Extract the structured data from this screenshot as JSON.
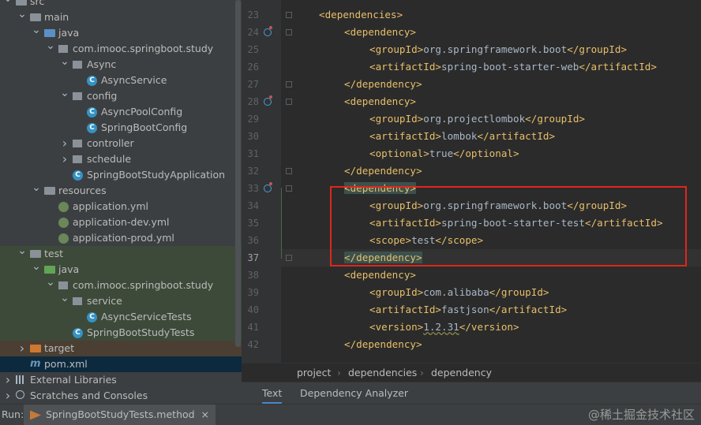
{
  "tree": {
    "items": [
      {
        "label": "src",
        "indent": 0,
        "arrow": "v",
        "icon": "folder"
      },
      {
        "label": "main",
        "indent": 1,
        "arrow": "v",
        "icon": "folder"
      },
      {
        "label": "java",
        "indent": 2,
        "arrow": "v",
        "icon": "folder-blue"
      },
      {
        "label": "com.imooc.springboot.study",
        "indent": 3,
        "arrow": "v",
        "icon": "package"
      },
      {
        "label": "Async",
        "indent": 4,
        "arrow": "v",
        "icon": "package"
      },
      {
        "label": "AsyncService",
        "indent": 5,
        "arrow": "",
        "icon": "class"
      },
      {
        "label": "config",
        "indent": 4,
        "arrow": "v",
        "icon": "package"
      },
      {
        "label": "AsyncPoolConfig",
        "indent": 5,
        "arrow": "",
        "icon": "class"
      },
      {
        "label": "SpringBootConfig",
        "indent": 5,
        "arrow": "",
        "icon": "class"
      },
      {
        "label": "controller",
        "indent": 4,
        "arrow": ">",
        "icon": "package"
      },
      {
        "label": "schedule",
        "indent": 4,
        "arrow": ">",
        "icon": "package"
      },
      {
        "label": "SpringBootStudyApplication",
        "indent": 4,
        "arrow": "",
        "icon": "class"
      },
      {
        "label": "resources",
        "indent": 2,
        "arrow": "v",
        "icon": "folder-res"
      },
      {
        "label": "application.yml",
        "indent": 3,
        "arrow": "",
        "icon": "yml"
      },
      {
        "label": "application-dev.yml",
        "indent": 3,
        "arrow": "",
        "icon": "yml"
      },
      {
        "label": "application-prod.yml",
        "indent": 3,
        "arrow": "",
        "icon": "yml"
      },
      {
        "label": "test",
        "indent": 1,
        "arrow": "v",
        "icon": "folder",
        "bg": "test"
      },
      {
        "label": "java",
        "indent": 2,
        "arrow": "v",
        "icon": "folder-green",
        "bg": "test"
      },
      {
        "label": "com.imooc.springboot.study",
        "indent": 3,
        "arrow": "v",
        "icon": "package",
        "bg": "test"
      },
      {
        "label": "service",
        "indent": 4,
        "arrow": "v",
        "icon": "package",
        "bg": "test"
      },
      {
        "label": "AsyncServiceTests",
        "indent": 5,
        "arrow": "",
        "icon": "class",
        "bg": "test"
      },
      {
        "label": "SpringBootStudyTests",
        "indent": 4,
        "arrow": "",
        "icon": "class",
        "bg": "test"
      },
      {
        "label": "target",
        "indent": 1,
        "arrow": ">",
        "icon": "folder-orange",
        "bg": "target"
      },
      {
        "label": "pom.xml",
        "indent": 1,
        "arrow": "",
        "icon": "maven",
        "bg": "sel"
      },
      {
        "label": "External Libraries",
        "indent": 0,
        "arrow": ">",
        "icon": "libs"
      },
      {
        "label": "Scratches and Consoles",
        "indent": 0,
        "arrow": ">",
        "icon": "scratch"
      }
    ]
  },
  "editor": {
    "first_line": 23,
    "current_line": 37,
    "lines": [
      {
        "n": 23,
        "indent": 1,
        "parts": [
          [
            "tg",
            "<dependencies>"
          ]
        ]
      },
      {
        "n": 24,
        "indent": 2,
        "parts": [
          [
            "tg",
            "<dependency>"
          ]
        ],
        "gicon": true
      },
      {
        "n": 25,
        "indent": 3,
        "parts": [
          [
            "tg",
            "<groupId>"
          ],
          [
            "tx",
            "org.springframework.boot"
          ],
          [
            "tg",
            "</groupId>"
          ]
        ]
      },
      {
        "n": 26,
        "indent": 3,
        "parts": [
          [
            "tg",
            "<artifactId>"
          ],
          [
            "tx",
            "spring-boot-starter-web"
          ],
          [
            "tg",
            "</artifactId>"
          ]
        ]
      },
      {
        "n": 27,
        "indent": 2,
        "parts": [
          [
            "tg",
            "</dependency>"
          ]
        ]
      },
      {
        "n": 28,
        "indent": 2,
        "parts": [
          [
            "tg",
            "<dependency>"
          ]
        ],
        "gicon": true
      },
      {
        "n": 29,
        "indent": 3,
        "parts": [
          [
            "tg",
            "<groupId>"
          ],
          [
            "tx",
            "org.projectlombok"
          ],
          [
            "tg",
            "</groupId>"
          ]
        ]
      },
      {
        "n": 30,
        "indent": 3,
        "parts": [
          [
            "tg",
            "<artifactId>"
          ],
          [
            "tx",
            "lombok"
          ],
          [
            "tg",
            "</artifactId>"
          ]
        ]
      },
      {
        "n": 31,
        "indent": 3,
        "parts": [
          [
            "tg",
            "<optional>"
          ],
          [
            "tx",
            "true"
          ],
          [
            "tg",
            "</optional>"
          ]
        ]
      },
      {
        "n": 32,
        "indent": 2,
        "parts": [
          [
            "tg",
            "</dependency>"
          ]
        ]
      },
      {
        "n": 33,
        "indent": 2,
        "parts": [
          [
            "tg hl",
            "<dependency>"
          ]
        ],
        "gicon": true
      },
      {
        "n": 34,
        "indent": 3,
        "parts": [
          [
            "tg",
            "<groupId>"
          ],
          [
            "tx",
            "org.springframework.boot"
          ],
          [
            "tg",
            "</groupId>"
          ]
        ]
      },
      {
        "n": 35,
        "indent": 3,
        "parts": [
          [
            "tg",
            "<artifactId>"
          ],
          [
            "tx",
            "spring-boot-starter-test"
          ],
          [
            "tg",
            "</artifactId>"
          ]
        ]
      },
      {
        "n": 36,
        "indent": 3,
        "parts": [
          [
            "tg",
            "<scope>"
          ],
          [
            "tx",
            "test"
          ],
          [
            "tg",
            "</scope>"
          ]
        ]
      },
      {
        "n": 37,
        "indent": 2,
        "parts": [
          [
            "tg hl",
            "</dependency>"
          ]
        ]
      },
      {
        "n": 38,
        "indent": 2,
        "parts": [
          [
            "tg",
            "<dependency>"
          ]
        ]
      },
      {
        "n": 39,
        "indent": 3,
        "parts": [
          [
            "tg",
            "<groupId>"
          ],
          [
            "tx",
            "com.alibaba"
          ],
          [
            "tg",
            "</groupId>"
          ]
        ]
      },
      {
        "n": 40,
        "indent": 3,
        "parts": [
          [
            "tg",
            "<artifactId>"
          ],
          [
            "tx",
            "fastjson"
          ],
          [
            "tg",
            "</artifactId>"
          ]
        ]
      },
      {
        "n": 41,
        "indent": 3,
        "parts": [
          [
            "tg",
            "<version>"
          ],
          [
            "tx squig",
            "1.2.31"
          ],
          [
            "tg",
            "</version>"
          ]
        ]
      },
      {
        "n": 42,
        "indent": 2,
        "parts": [
          [
            "tg",
            "</dependency>"
          ]
        ]
      }
    ]
  },
  "breadcrumb": [
    "project",
    "dependencies",
    "dependency"
  ],
  "bottom_tabs": [
    {
      "label": "Text",
      "active": true
    },
    {
      "label": "Dependency Analyzer",
      "active": false
    }
  ],
  "run": {
    "label": "Run:",
    "tab": "SpringBootStudyTests.method",
    "close": "×"
  },
  "watermark": "@稀土掘金技术社区"
}
